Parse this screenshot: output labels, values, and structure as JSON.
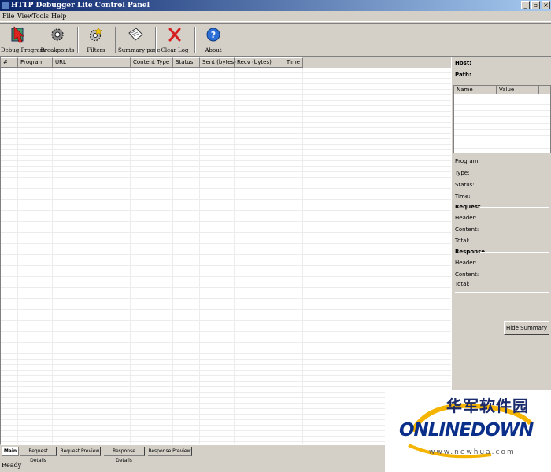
{
  "window": {
    "title": "HTTP Debugger Lite Control Panel",
    "min": "_",
    "max": "▫",
    "close": "×"
  },
  "menu": [
    "File",
    "View",
    "Tools",
    "Help"
  ],
  "toolbar": [
    {
      "label": "Debug Program",
      "icon": "debug-program-icon"
    },
    {
      "label": "Breakpoints",
      "icon": "breakpoints-gear-icon"
    },
    {
      "label": "Filters",
      "icon": "filters-gear-icon"
    },
    {
      "label": "Summary pane",
      "icon": "summary-pane-icon"
    },
    {
      "label": "Clear Log",
      "icon": "clear-log-x-icon"
    },
    {
      "label": "About",
      "icon": "about-help-icon"
    }
  ],
  "table": {
    "columns": [
      "#",
      "Program",
      "URL",
      "Content Type",
      "Status",
      "Sent (bytes)",
      "Recv (bytes)",
      "Time"
    ]
  },
  "summary": {
    "host_label": "Host:",
    "path_label": "Path:",
    "grid_columns": [
      "Name",
      "Value"
    ],
    "program_label": "Program:",
    "type_label": "Type:",
    "status_label": "Status:",
    "time_label": "Time:",
    "request_heading": "Request",
    "request_header": "Header:",
    "request_content": "Content:",
    "request_total": "Total:",
    "response_heading": "Response",
    "response_header": "Header:",
    "response_content": "Content:",
    "response_total": "Total:",
    "hide_button": "Hide Summary"
  },
  "tabs": [
    "Main",
    "Request Details",
    "Request Preview",
    "Response Details",
    "Response Preview"
  ],
  "status": "Ready",
  "watermark": {
    "cn": "华军软件园",
    "logo": "ONLINEDOWN",
    "url": "www.newhua.com"
  }
}
